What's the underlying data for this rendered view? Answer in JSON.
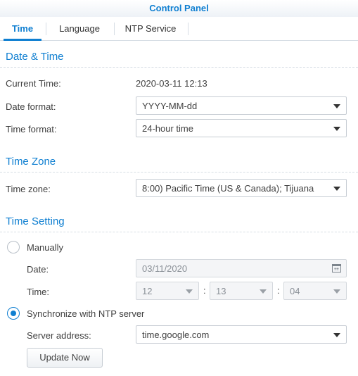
{
  "window": {
    "title": "Control Panel"
  },
  "tabs": [
    {
      "label": "Time",
      "active": true
    },
    {
      "label": "Language",
      "active": false
    },
    {
      "label": "NTP Service",
      "active": false
    }
  ],
  "date_time": {
    "title": "Date & Time",
    "current_time_label": "Current Time:",
    "current_time_value": "2020-03-11 12:13",
    "date_format_label": "Date format:",
    "date_format_value": "YYYY-MM-dd",
    "time_format_label": "Time format:",
    "time_format_value": "24-hour time"
  },
  "time_zone": {
    "title": "Time Zone",
    "label": "Time zone:",
    "value": "8:00) Pacific Time (US & Canada); Tijuana"
  },
  "time_setting": {
    "title": "Time Setting",
    "manual_label": "Manually",
    "manual_checked": false,
    "date_label": "Date:",
    "date_value": "03/11/2020",
    "time_label": "Time:",
    "hour": "12",
    "minute": "13",
    "second": "04",
    "separator": ":",
    "ntp_label": "Synchronize with NTP server",
    "ntp_checked": true,
    "server_label": "Server address:",
    "server_value": "time.google.com",
    "update_button": "Update Now"
  },
  "colors": {
    "accent": "#0f7fd1",
    "text": "#404040",
    "border": "#c6ccd3"
  }
}
